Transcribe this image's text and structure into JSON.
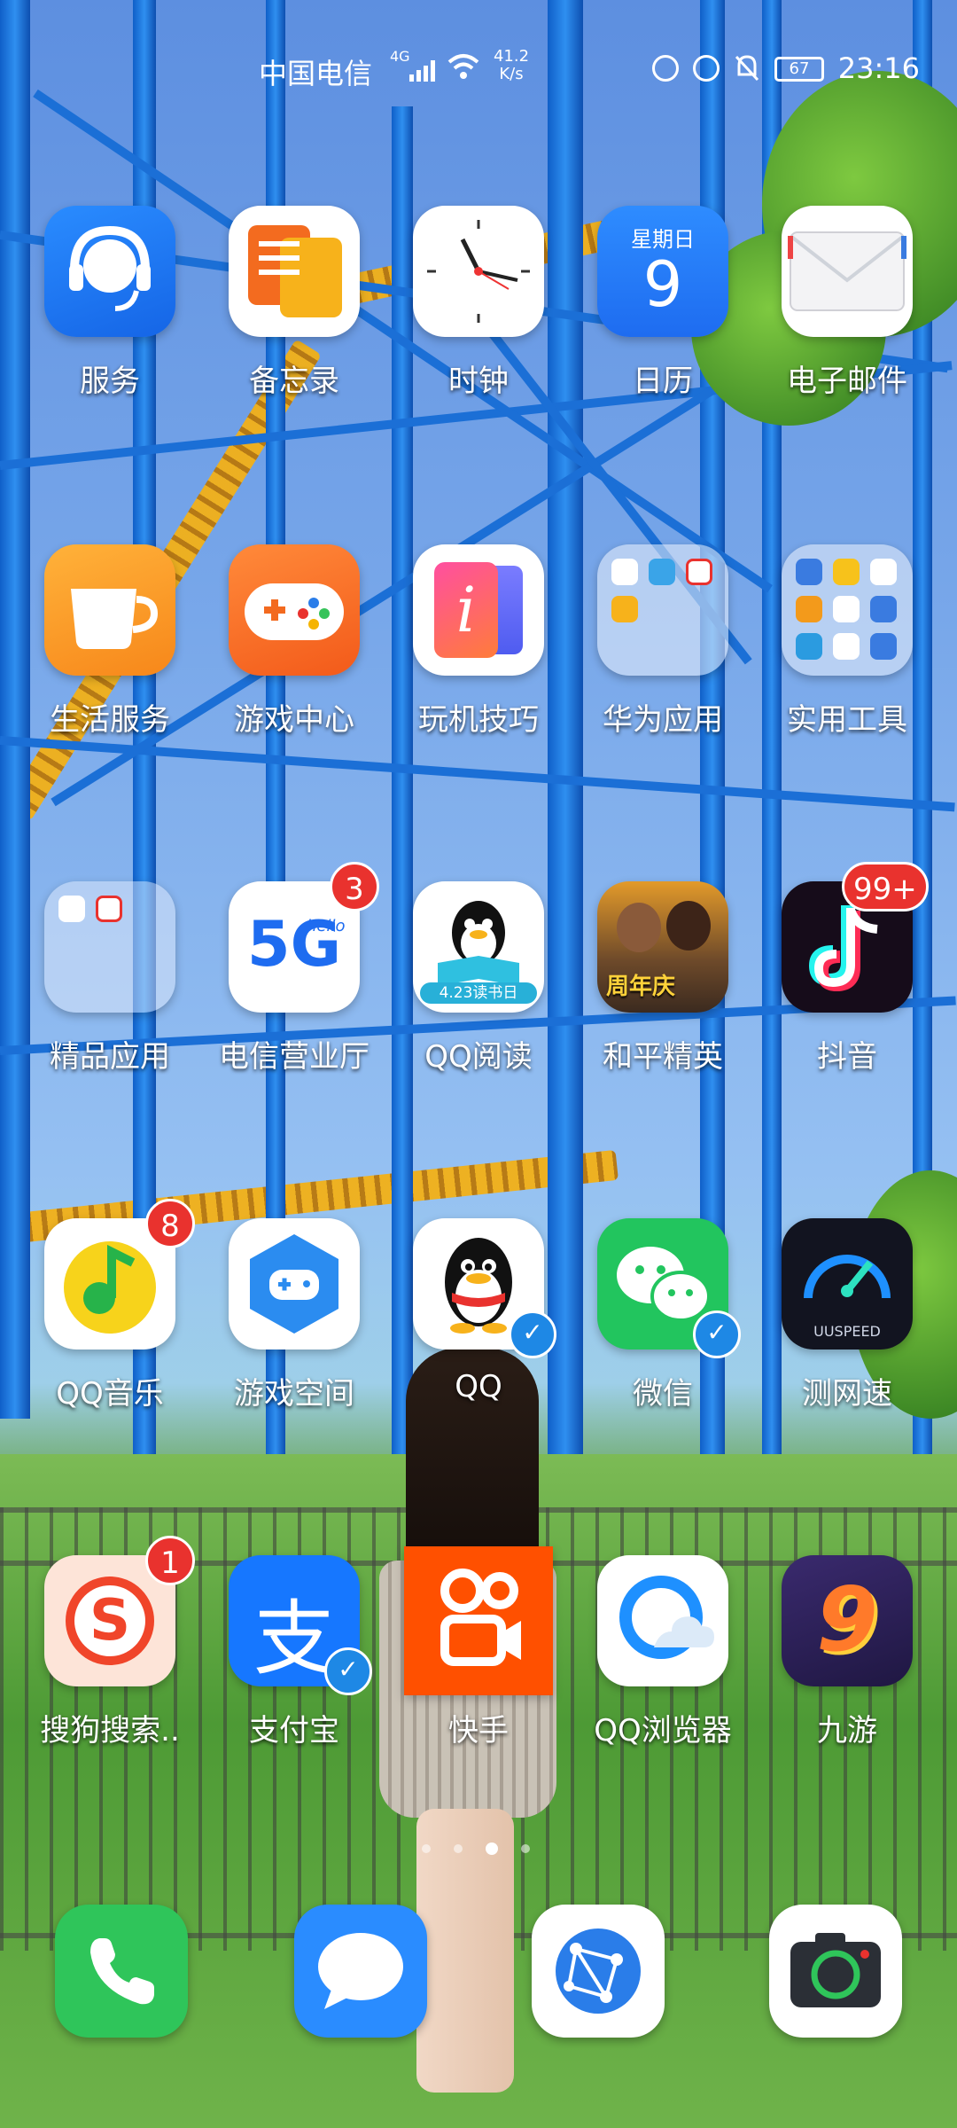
{
  "status_bar": {
    "carrier": "中国电信",
    "network": "4G",
    "speed": "41.2 K/s",
    "battery": "67",
    "time": "23:16"
  },
  "apps": {
    "fuwu": {
      "label": "服务",
      "icon": "headset-icon"
    },
    "beiwanglu": {
      "label": "备忘录",
      "icon": "notes-icon"
    },
    "shizhong": {
      "label": "时钟",
      "icon": "clock-icon"
    },
    "rili": {
      "label": "日历",
      "icon": "calendar-icon",
      "weekday": "星期日",
      "day": "9"
    },
    "email": {
      "label": "电子邮件",
      "icon": "envelope-icon"
    },
    "shenghuo": {
      "label": "生活服务",
      "icon": "cup-icon"
    },
    "youxi": {
      "label": "游戏中心",
      "icon": "gamepad-icon"
    },
    "wanji": {
      "label": "玩机技巧",
      "icon": "tips-icon",
      "glyph": "i"
    },
    "huawei_apps": {
      "label": "华为应用",
      "icon": "folder-icon"
    },
    "tools": {
      "label": "实用工具",
      "icon": "folder-icon"
    },
    "jingpin": {
      "label": "精品应用",
      "icon": "folder-icon"
    },
    "dianxin": {
      "label": "电信营业厅",
      "icon": "5g-icon",
      "badge": "3",
      "glyph": "5G",
      "sub": "hello"
    },
    "qqread": {
      "label": "QQ阅读",
      "icon": "penguin-book-icon",
      "banner": "4.23读书日"
    },
    "heping": {
      "label": "和平精英",
      "icon": "game-character-icon",
      "banner": "周年庆"
    },
    "douyin": {
      "label": "抖音",
      "icon": "music-note-icon",
      "badge": "99+"
    },
    "qqmusic": {
      "label": "QQ音乐",
      "icon": "music-icon",
      "badge": "8"
    },
    "game_space": {
      "label": "游戏空间",
      "icon": "game-space-icon"
    },
    "qq": {
      "label": "QQ",
      "icon": "penguin-icon",
      "verified": "✓"
    },
    "wechat": {
      "label": "微信",
      "icon": "chat-bubbles-icon",
      "verified": "✓"
    },
    "cewangsu": {
      "label": "测网速",
      "icon": "speedometer-icon",
      "brand": "UUSPEED"
    },
    "sogou": {
      "label": "搜狗搜索..",
      "icon": "sogou-icon",
      "badge": "1",
      "glyph": "S"
    },
    "alipay": {
      "label": "支付宝",
      "icon": "alipay-icon",
      "glyph": "支",
      "verified": "✓"
    },
    "kuaishou": {
      "label": "快手",
      "icon": "video-camera-icon"
    },
    "qqbrowser": {
      "label": "QQ浏览器",
      "icon": "browser-icon"
    },
    "jiuyou": {
      "label": "九游",
      "icon": "jiuyou-icon",
      "glyph": "9"
    }
  },
  "dock": {
    "phone": {
      "icon": "phone-icon"
    },
    "messages": {
      "icon": "message-icon"
    },
    "browser": {
      "icon": "globe-icon"
    },
    "camera": {
      "icon": "camera-icon"
    }
  },
  "page_indicator": {
    "pages": 4,
    "active": 3
  },
  "colors": {
    "badge": "#e9322e",
    "verified": "#1e88e5"
  }
}
